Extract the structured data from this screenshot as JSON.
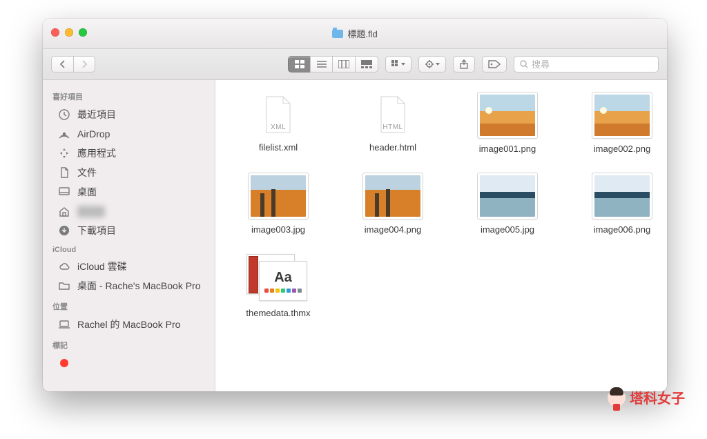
{
  "window": {
    "title": "標題.fld"
  },
  "toolbar": {
    "search_placeholder": "搜尋"
  },
  "sidebar": {
    "groups": [
      {
        "title": "喜好項目",
        "items": [
          {
            "icon": "clock",
            "label": "最近項目"
          },
          {
            "icon": "airdrop",
            "label": "AirDrop"
          },
          {
            "icon": "apps",
            "label": "應用程式"
          },
          {
            "icon": "doc",
            "label": "文件"
          },
          {
            "icon": "desktop",
            "label": "桌面"
          },
          {
            "icon": "home",
            "label": "",
            "blur": true
          },
          {
            "icon": "download",
            "label": "下載項目"
          }
        ]
      },
      {
        "title": "iCloud",
        "items": [
          {
            "icon": "cloud",
            "label": "iCloud 雲碟"
          },
          {
            "icon": "folder",
            "label": "桌面 - Rache's MacBook Pro"
          }
        ]
      },
      {
        "title": "位置",
        "items": [
          {
            "icon": "laptop",
            "label": "Rachel 的 MacBook Pro"
          }
        ]
      },
      {
        "title": "標記",
        "items": [
          {
            "icon": "tag-red",
            "label": ""
          }
        ]
      }
    ]
  },
  "files": [
    {
      "name": "filelist.xml",
      "kind": "doc",
      "badge": "XML"
    },
    {
      "name": "header.html",
      "kind": "doc",
      "badge": "HTML"
    },
    {
      "name": "image001.png",
      "kind": "photo",
      "scene": "sunset"
    },
    {
      "name": "image002.png",
      "kind": "photo",
      "scene": "sunset"
    },
    {
      "name": "image003.jpg",
      "kind": "photo",
      "scene": "forest"
    },
    {
      "name": "image004.png",
      "kind": "photo",
      "scene": "forest"
    },
    {
      "name": "image005.jpg",
      "kind": "photo",
      "scene": "lake"
    },
    {
      "name": "image006.png",
      "kind": "photo",
      "scene": "lake"
    },
    {
      "name": "themedata.thmx",
      "kind": "thmx"
    }
  ],
  "watermark": "塔科女子"
}
